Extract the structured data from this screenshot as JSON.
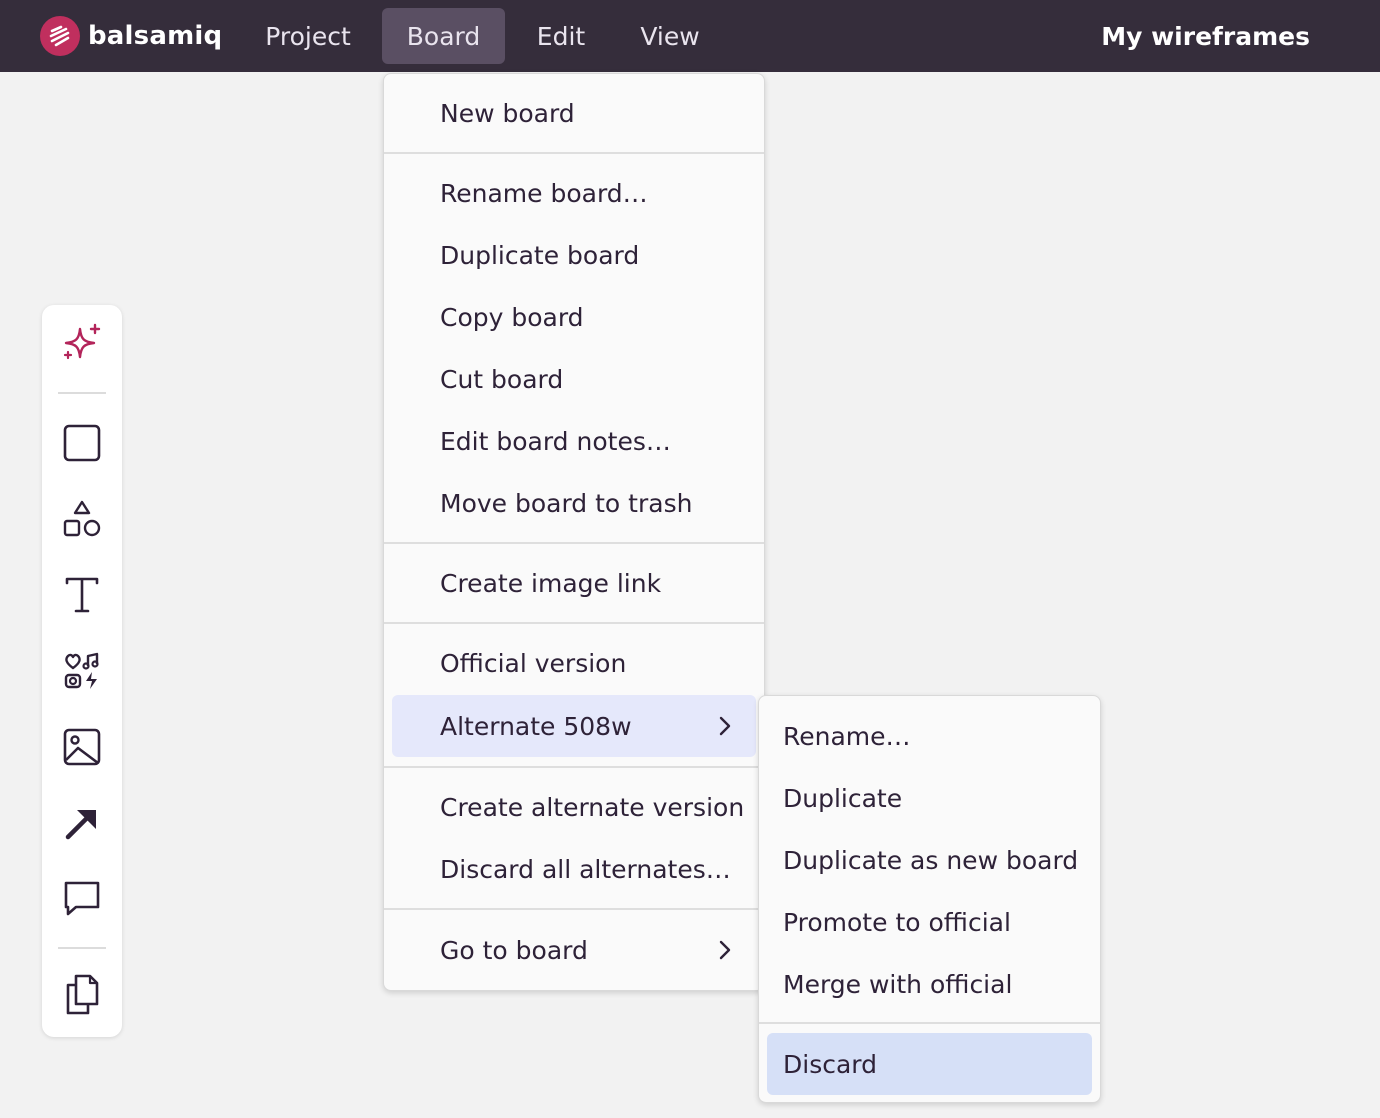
{
  "app": {
    "brand": "balsamiq",
    "menu": [
      "Project",
      "Board",
      "Edit",
      "View"
    ],
    "active_menu": "Board",
    "right_label": "My wireframes"
  },
  "toolbar": {
    "tools": [
      "ai-sparkle-icon",
      "rectangle-icon",
      "shapes-icon",
      "text-icon",
      "icons-library-icon",
      "image-icon",
      "arrow-icon",
      "comment-icon",
      "copy-pages-icon"
    ]
  },
  "board_menu": {
    "new_board": "New board",
    "rename_board": "Rename board…",
    "duplicate_board": "Duplicate board",
    "copy_board": "Copy board",
    "cut_board": "Cut board",
    "edit_notes": "Edit board notes…",
    "move_trash": "Move board to trash",
    "create_image_link": "Create image link",
    "official_version": "Official version",
    "alternate": "Alternate 508w",
    "create_alternate": "Create alternate version",
    "discard_alternates": "Discard all alternates…",
    "go_to_board": "Go to board"
  },
  "alternate_submenu": {
    "rename": "Rename…",
    "duplicate": "Duplicate",
    "duplicate_new_board": "Duplicate as new board",
    "promote": "Promote to official",
    "merge": "Merge with official",
    "discard": "Discard"
  },
  "colors": {
    "topbar": "#352d3b",
    "accent": "#c02f5e",
    "highlight": "#e5e8fb",
    "submenu_highlight": "#d6e0f7"
  }
}
